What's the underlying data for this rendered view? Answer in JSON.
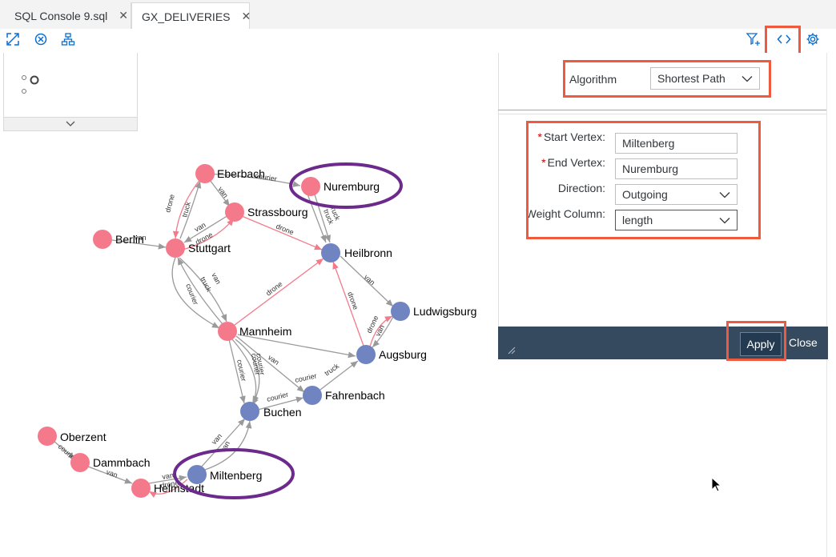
{
  "tabs": [
    {
      "label": "SQL Console 9.sql",
      "close": "✕"
    },
    {
      "label": "GX_DELIVERIES",
      "close": "✕"
    }
  ],
  "toolbar": {
    "left_icons": [
      "fit-screen-icon",
      "clear-selection-icon",
      "hierarchy-icon"
    ],
    "right_icons": [
      "add-filter-icon",
      "code-toggle-icon",
      "settings-icon"
    ]
  },
  "panel": {
    "algorithm_label": "Algorithm",
    "algorithm_value": "Shortest Path",
    "required_marker": "*",
    "start_label": "Start Vertex:",
    "start_value": "Miltenberg",
    "end_label": "End Vertex:",
    "end_value": "Nuremburg",
    "direction_label": "Direction:",
    "direction_value": "Outgoing",
    "weight_label": "Weight Column:",
    "weight_value": "length",
    "apply_label": "Apply",
    "close_label": "Close"
  },
  "colors": {
    "pink_node": "#f47a8b",
    "blue_node": "#6f84c0",
    "highlight_red": "#ef5a3e",
    "highlight_purple": "#6b2a8c",
    "footer_bg": "#354a5f"
  },
  "graph": {
    "nodes": [
      {
        "id": "eberbach",
        "label": "Eberbach",
        "color": "pink"
      },
      {
        "id": "nuremburg",
        "label": "Nuremburg",
        "color": "pink"
      },
      {
        "id": "strassbourg",
        "label": "Strassbourg",
        "color": "pink"
      },
      {
        "id": "berlin",
        "label": "Berlin",
        "color": "pink"
      },
      {
        "id": "stuttgart",
        "label": "Stuttgart",
        "color": "pink"
      },
      {
        "id": "heilbronn",
        "label": "Heilbronn",
        "color": "blue"
      },
      {
        "id": "ludwigsburg",
        "label": "Ludwigsburg",
        "color": "blue"
      },
      {
        "id": "mannheim",
        "label": "Mannheim",
        "color": "pink"
      },
      {
        "id": "augsburg",
        "label": "Augsburg",
        "color": "blue"
      },
      {
        "id": "fahrenbach",
        "label": "Fahrenbach",
        "color": "blue"
      },
      {
        "id": "buchen",
        "label": "Buchen",
        "color": "blue"
      },
      {
        "id": "oberzent",
        "label": "Oberzent",
        "color": "pink"
      },
      {
        "id": "dammbach",
        "label": "Dammbach",
        "color": "pink"
      },
      {
        "id": "heimstadt",
        "label": "Helmstadt",
        "color": "pink"
      },
      {
        "id": "miltenberg",
        "label": "Miltenberg",
        "color": "blue"
      }
    ],
    "edge_labels": {
      "courier": "courier",
      "van": "van",
      "drone": "drone",
      "truck": "truck"
    }
  }
}
